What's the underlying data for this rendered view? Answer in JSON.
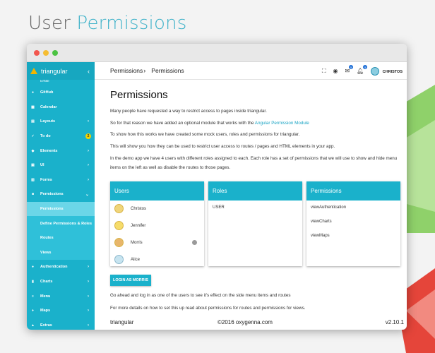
{
  "page": {
    "heading_plain": "User",
    "heading_highlight": "Permissions"
  },
  "colors": {
    "accent": "#1ab1cb",
    "highlight_text": "#3fb2c9",
    "badge_yellow": "#f2d300",
    "bg_green": "#7ec857",
    "bg_red": "#e5453a"
  },
  "window": {
    "controls": [
      "close",
      "minimize",
      "maximize"
    ]
  },
  "sidebar": {
    "app_title": "triangular",
    "collapse_icon": "chevron-left-icon",
    "cut_label": "Email",
    "items": [
      {
        "label": "GitHub",
        "icon": "github-icon",
        "arrow": ""
      },
      {
        "label": "Calendar",
        "icon": "calendar-icon",
        "arrow": ""
      },
      {
        "label": "Layouts",
        "icon": "layouts-icon",
        "arrow": "›"
      },
      {
        "label": "To do",
        "icon": "check-icon",
        "badge": "2",
        "arrow": ""
      },
      {
        "label": "Elements",
        "icon": "elements-icon",
        "arrow": "›"
      },
      {
        "label": "UI",
        "icon": "ui-icon",
        "arrow": "›"
      },
      {
        "label": "Forms",
        "icon": "forms-icon",
        "arrow": "›"
      },
      {
        "label": "Permissions",
        "icon": "lock-icon",
        "arrow": "⌄"
      }
    ],
    "subitems": [
      {
        "label": "Permissions",
        "active": true
      },
      {
        "label": "Define Permissions & Roles",
        "active": false
      },
      {
        "label": "Routes",
        "active": false
      },
      {
        "label": "Views",
        "active": false
      }
    ],
    "items_after": [
      {
        "label": "Authentication",
        "icon": "person-icon",
        "arrow": "›"
      },
      {
        "label": "Charts",
        "icon": "chart-icon",
        "arrow": "›"
      },
      {
        "label": "Menu",
        "icon": "menu-icon",
        "arrow": "›"
      },
      {
        "label": "Maps",
        "icon": "map-pin-icon",
        "arrow": "›"
      },
      {
        "label": "Extras",
        "icon": "extras-icon",
        "arrow": "›"
      }
    ]
  },
  "topbar": {
    "crumb_parent": "Permissions",
    "crumb_sep": "›",
    "crumb_current": "Permissions",
    "badges": {
      "messages": "5",
      "notifications": "5"
    },
    "user_name": "CHRISTOS"
  },
  "main": {
    "title": "Permissions",
    "paragraphs": {
      "p1": "Many people have requested a way to restrict access to pages inside triangular.",
      "p2_before": "So for that reason we have added an optional module that works with the ",
      "p2_link": "Angular Permission Module",
      "p3": "To show how this works we have created some mock users, roles and permissions for triangular.",
      "p4": "This will show you how they can be used to restrict user access to routes / pages and HTML elements in your app.",
      "p5": "In the demo app we have 4 users with different roles assigned to each. Each role has a set of permissions that we will use to show and hide menu items on the left as well as disable the routes to those pages."
    },
    "cards": {
      "users_title": "Users",
      "users": [
        "Christos",
        "Jennifer",
        "Morris",
        "Alice"
      ],
      "roles_title": "Roles",
      "roles": [
        "USER"
      ],
      "permissions_title": "Permissions",
      "permissions": [
        "viewAuthentication",
        "viewCharts",
        "viewMaps"
      ]
    },
    "login_button": "LOGIN AS MORRIS",
    "after1": "Go ahead and log in as one of the users to see it's effect on the side menu items and routes",
    "after2": "For more details on how to set this up read about permissions for routes and permissions for views."
  },
  "footer": {
    "left": "triangular",
    "center": "©2016 oxygenna.com",
    "right": "v2.10.1"
  }
}
